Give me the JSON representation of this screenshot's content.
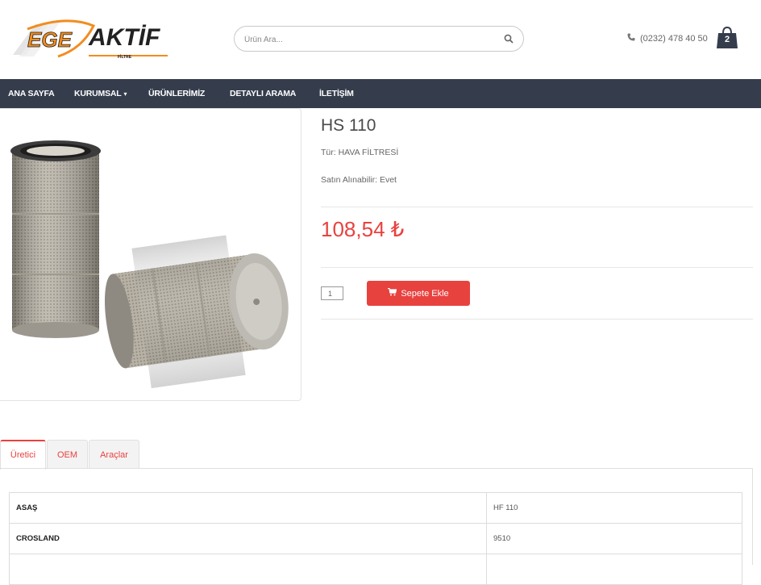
{
  "header": {
    "logo_text_1": "EGE",
    "logo_text_2": "AKTİF",
    "logo_sub": "FİLTRE",
    "search_placeholder": "Ürün Ara...",
    "phone": "(0232) 478 40 50",
    "cart_count": "2"
  },
  "nav": {
    "items": [
      {
        "label": "ANA SAYFA"
      },
      {
        "label": "KURUMSAL"
      },
      {
        "label": "ÜRÜNLERİMİZ"
      },
      {
        "label": "DETAYLI ARAMA"
      },
      {
        "label": "İLETİŞİM"
      }
    ]
  },
  "product": {
    "title": "HS 110",
    "type": "Tür: HAVA FİLTRESİ",
    "availability": "Satın Alınabilir: Evet",
    "price": "108,54 ₺",
    "quantity": "1",
    "add_to_cart": "Sepete Ekle"
  },
  "tabs": [
    {
      "label": "Üretici",
      "active": true
    },
    {
      "label": "OEM",
      "active": false
    },
    {
      "label": "Araçlar",
      "active": false
    }
  ],
  "manufacturers": [
    {
      "name": "ASAŞ",
      "code": "HF 110"
    },
    {
      "name": "CROSLAND",
      "code": "9510"
    }
  ],
  "colors": {
    "accent": "#e8423f",
    "nav_bg": "#353d4d",
    "logo_orange": "#f28c1e"
  }
}
